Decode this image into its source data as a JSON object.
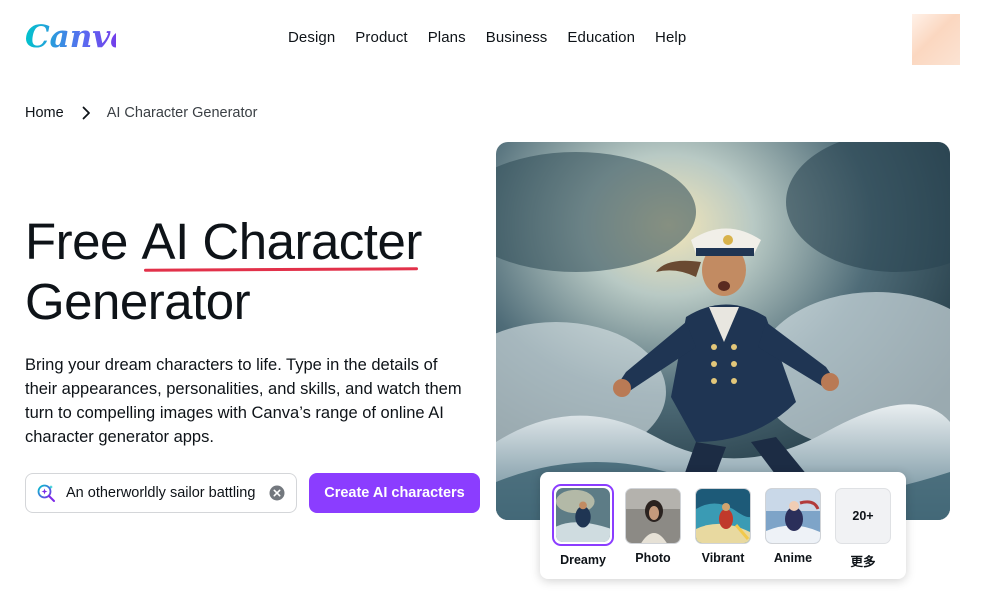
{
  "header": {
    "logo_text": "Canva",
    "nav": [
      "Design",
      "Product",
      "Plans",
      "Business",
      "Education",
      "Help"
    ]
  },
  "breadcrumb": {
    "home": "Home",
    "current": "AI Character Generator"
  },
  "hero": {
    "title_prefix": "Free ",
    "title_highlight": "AI Character",
    "title_suffix": "Generator",
    "description": "Bring your dream characters to life. Type in the details of their appearances, personalities, and skills, and watch them turn to compelling images with Canva’s range of online AI character generator apps.",
    "search_value": "An otherworldly sailor battling the waves",
    "cta_label": "Create AI characters"
  },
  "styles": {
    "options": [
      {
        "label": "Dreamy",
        "selected": true
      },
      {
        "label": "Photo",
        "selected": false
      },
      {
        "label": "Vibrant",
        "selected": false
      },
      {
        "label": "Anime",
        "selected": false
      }
    ],
    "more_count": "20+",
    "more_label": "更多"
  },
  "colors": {
    "brand_purple": "#8b3dff",
    "underline_red": "#e2314a"
  }
}
